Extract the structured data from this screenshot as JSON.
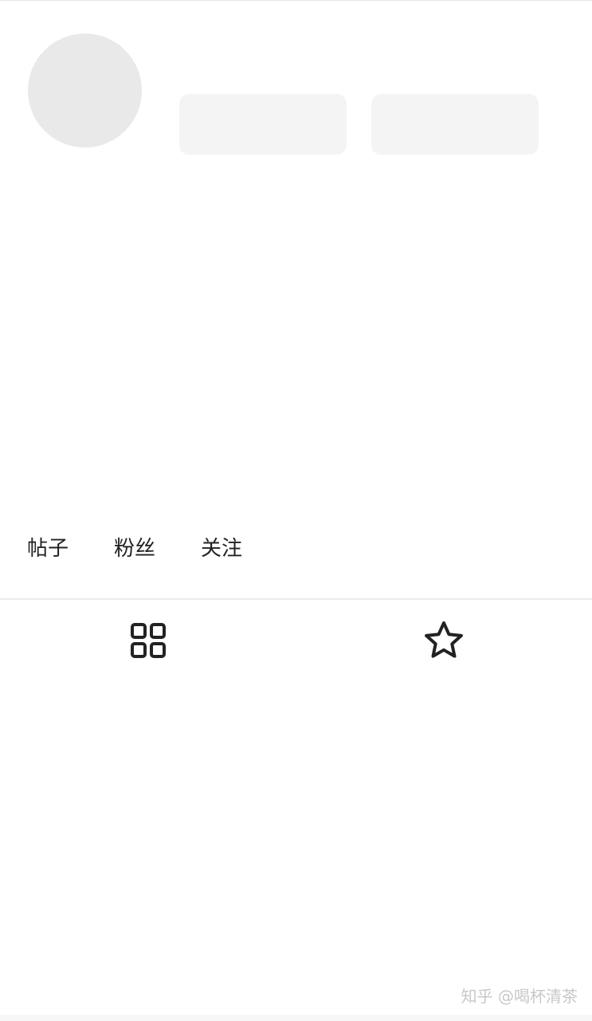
{
  "profile": {
    "avatar_state": "loading-placeholder",
    "action_placeholders": 2
  },
  "stats": [
    {
      "label": "帖子"
    },
    {
      "label": "粉丝"
    },
    {
      "label": "关注"
    }
  ],
  "tabs": [
    {
      "icon": "grid-icon"
    },
    {
      "icon": "star-icon"
    }
  ],
  "watermark": "知乎 @喝杯清茶",
  "colors": {
    "placeholder_avatar": "#e9e9e9",
    "placeholder_button": "#f4f4f4",
    "text": "#222222",
    "icon": "#222222",
    "watermark": "#c8c8c8"
  }
}
